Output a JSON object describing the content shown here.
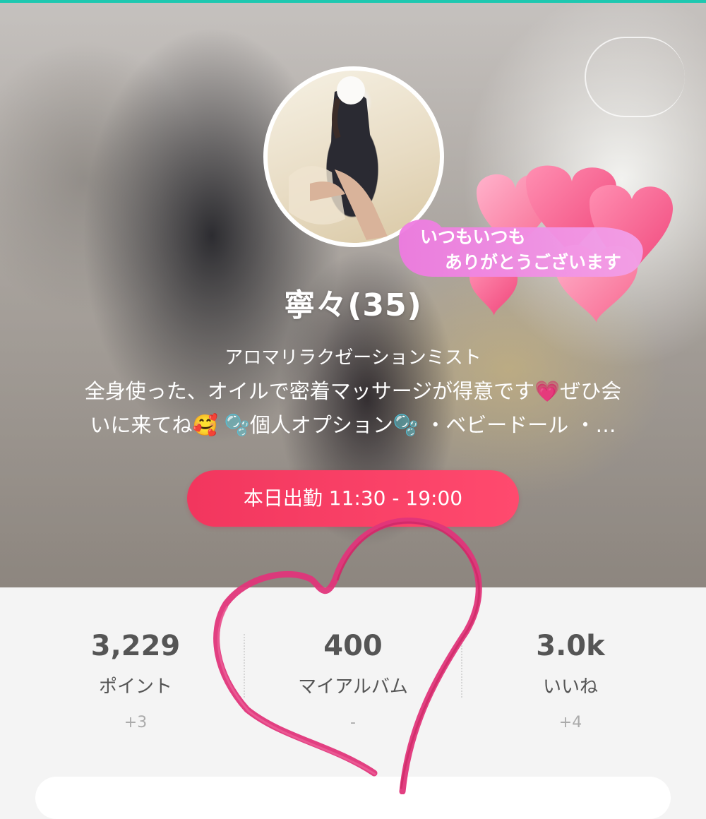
{
  "profile": {
    "name": "寧々(35)",
    "role": "アロマリラクゼーションミスト",
    "bio_line1": "全身使った、オイルで密着マッサージが得意です💗ぜひ会",
    "bio_line2": "いに来てね🥰 🫧個人オプション🫧 ・ベビードール ・…",
    "sticker_line1": "いつもいつも",
    "sticker_line2": "ありがとうございます"
  },
  "shift": {
    "label": "本日出勤 11:30 - 19:00"
  },
  "stats": [
    {
      "value": "3,229",
      "label": "ポイント",
      "delta": "+3"
    },
    {
      "value": "400",
      "label": "マイアルバム",
      "delta": "-"
    },
    {
      "value": "3.0k",
      "label": "いいね",
      "delta": "+4"
    }
  ],
  "colors": {
    "accent": "#f2365e",
    "heart_stroke": "#e0357a",
    "top_line": "#1ec8b0"
  },
  "icons": [
    "heart-outline-icon",
    "heart-cluster-sticker"
  ]
}
